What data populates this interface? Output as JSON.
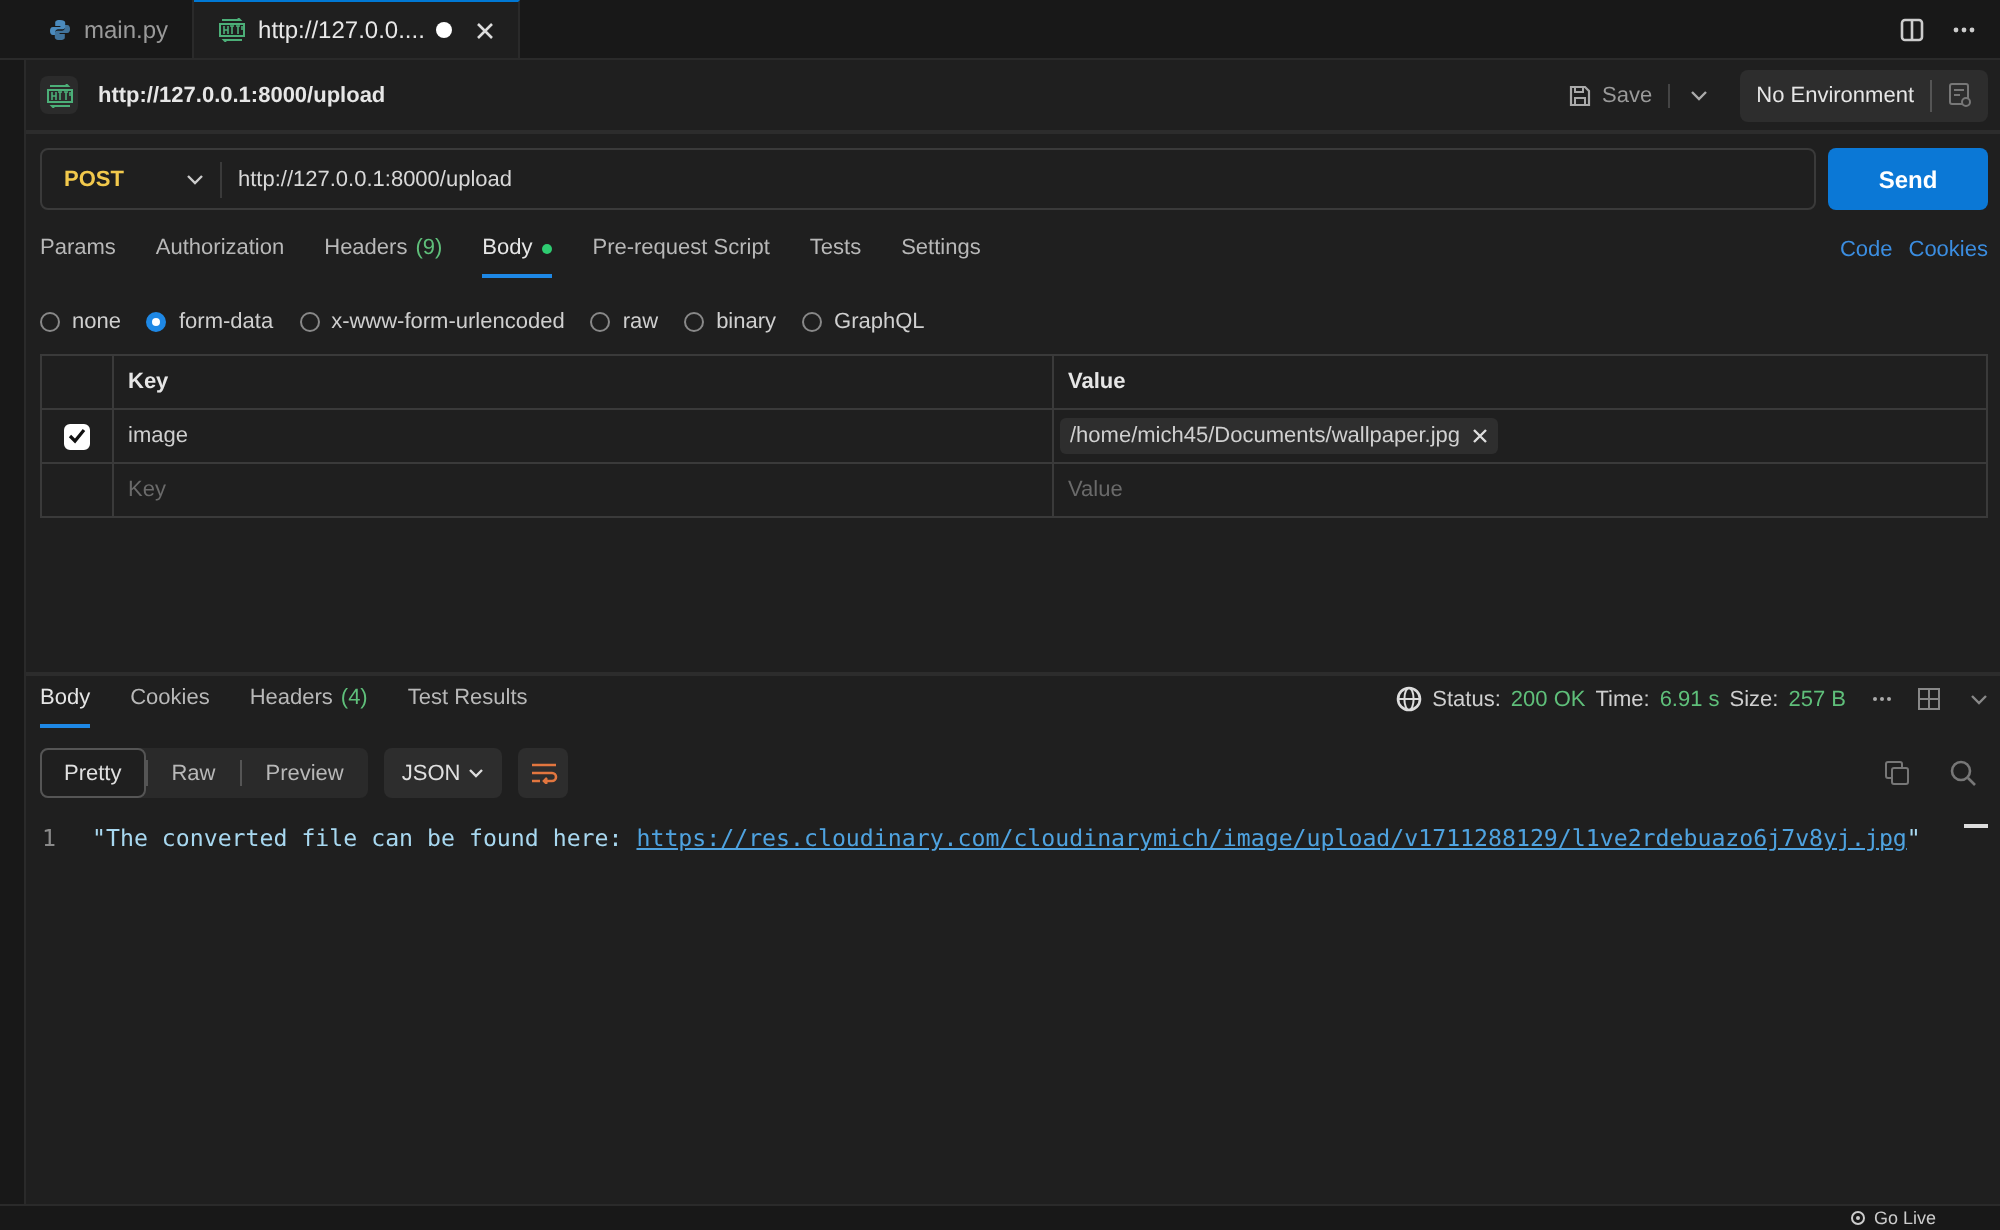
{
  "editor_tabs": [
    {
      "label": "main.py",
      "kind": "python",
      "selected": false,
      "modified": false
    },
    {
      "label": "http://127.0.0....",
      "kind": "http",
      "selected": true,
      "modified": true
    }
  ],
  "request": {
    "title": "http://127.0.0.1:8000/upload",
    "save": "Save",
    "environment": "No Environment",
    "method": "POST",
    "url": "http://127.0.0.1:8000/upload",
    "send": "Send"
  },
  "request_tabs": [
    {
      "label": "Params",
      "selected": false,
      "dot": false
    },
    {
      "label": "Authorization",
      "selected": false,
      "dot": false
    },
    {
      "label": "Headers",
      "count": "(9)",
      "selected": false,
      "dot": false
    },
    {
      "label": "Body",
      "selected": true,
      "dot": true
    },
    {
      "label": "Pre-request Script",
      "selected": false,
      "dot": false
    },
    {
      "label": "Tests",
      "selected": false,
      "dot": false
    },
    {
      "label": "Settings",
      "selected": false,
      "dot": false
    }
  ],
  "request_links": [
    "Code",
    "Cookies"
  ],
  "body_types": [
    {
      "label": "none",
      "selected": false
    },
    {
      "label": "form-data",
      "selected": true
    },
    {
      "label": "x-www-form-urlencoded",
      "selected": false
    },
    {
      "label": "raw",
      "selected": false
    },
    {
      "label": "binary",
      "selected": false
    },
    {
      "label": "GraphQL",
      "selected": false
    }
  ],
  "form_table": {
    "columns": [
      "Key",
      "Value"
    ],
    "rows": [
      {
        "checked": true,
        "key": "image",
        "value": "/home/mich45/Documents/wallpaper.jpg"
      }
    ],
    "new_row": {
      "key_placeholder": "Key",
      "value_placeholder": "Value"
    }
  },
  "response": {
    "tabs": [
      {
        "label": "Body",
        "selected": true
      },
      {
        "label": "Cookies",
        "selected": false
      },
      {
        "label": "Headers",
        "count": "(4)",
        "selected": false
      },
      {
        "label": "Test Results",
        "selected": false
      }
    ],
    "status_label": "Status:",
    "status": "200 OK",
    "time_label": "Time:",
    "time": "6.91 s",
    "size_label": "Size:",
    "size": "257 B",
    "view_modes": [
      {
        "label": "Pretty",
        "selected": true
      },
      {
        "label": "Raw",
        "selected": false
      },
      {
        "label": "Preview",
        "selected": false
      }
    ],
    "format": "JSON",
    "lines": [
      {
        "number": "1",
        "text": "\"The converted file can be found here: ",
        "link": "https://res.cloudinary.com/cloudinarymich/image/upload/v1711288129/l1ve2rdebuazo6j7v8yj.jpg",
        "end": "\""
      }
    ]
  },
  "status_bar": {
    "go_live": "Go Live"
  }
}
